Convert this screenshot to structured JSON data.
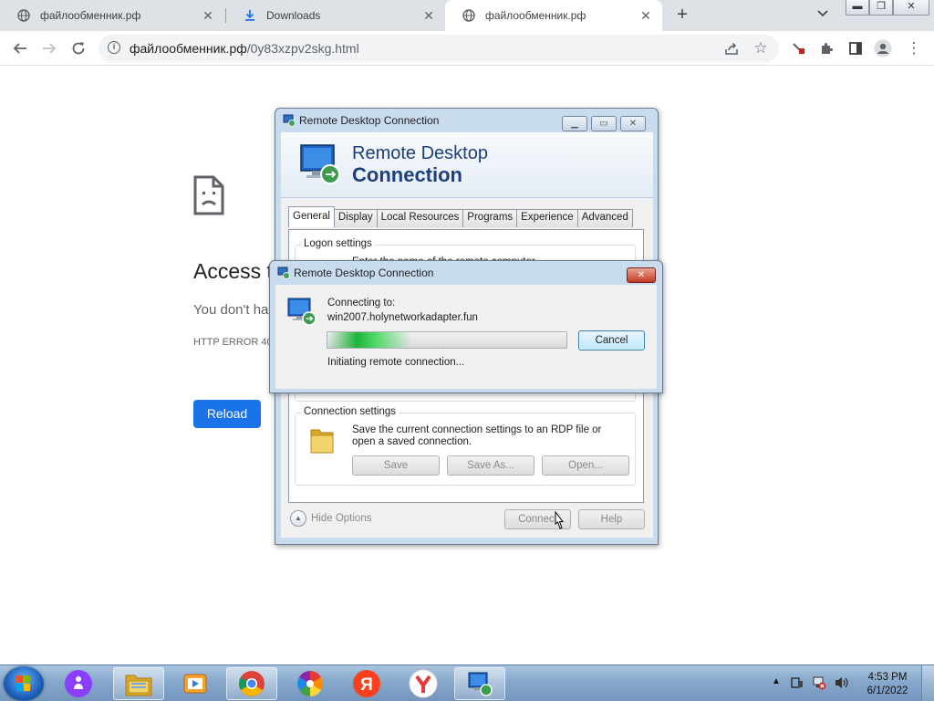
{
  "browser": {
    "tabs": [
      {
        "title": "файлообменник.рф",
        "icon": "globe-icon",
        "active": false
      },
      {
        "title": "Downloads",
        "icon": "download-icon",
        "active": false
      },
      {
        "title": "файлообменник.рф",
        "icon": "globe-icon",
        "active": true
      }
    ],
    "address": {
      "host": "файлообменник.рф",
      "path": "/0y83xzpv2skg.html"
    }
  },
  "page": {
    "error_title": "Access t",
    "error_message": "You don't ha",
    "error_code": "HTTP ERROR 40",
    "reload_label": "Reload"
  },
  "rdc_window": {
    "title": "Remote Desktop Connection",
    "header_line1": "Remote Desktop",
    "header_line2": "Connection",
    "tabs": [
      "General",
      "Display",
      "Local Resources",
      "Programs",
      "Experience",
      "Advanced"
    ],
    "logon_group_label": "Logon settings",
    "logon_partial_text": "Enter the name of the remote computer.",
    "connection_group_label": "Connection settings",
    "connection_description": "Save the current connection settings to an RDP file or open a saved connection.",
    "save_label": "Save",
    "save_as_label": "Save As...",
    "open_label": "Open...",
    "hide_options_label": "Hide Options",
    "connect_label": "Connect",
    "help_label": "Help"
  },
  "connecting_dialog": {
    "title": "Remote Desktop Connection",
    "connecting_to_label": "Connecting to:",
    "host": "win2007.holynetworkadapter.fun",
    "progress": 0.35,
    "status": "Initiating remote connection...",
    "cancel_label": "Cancel"
  },
  "taskbar": {
    "items": [
      "start-orb",
      "alice-icon",
      "explorer-icon",
      "media-player-icon",
      "chrome-icon",
      "pinwheel-icon",
      "yandex-icon",
      "yandex-browser-icon",
      "remote-desktop-icon"
    ],
    "time": "4:53 PM",
    "date": "6/1/2022"
  }
}
